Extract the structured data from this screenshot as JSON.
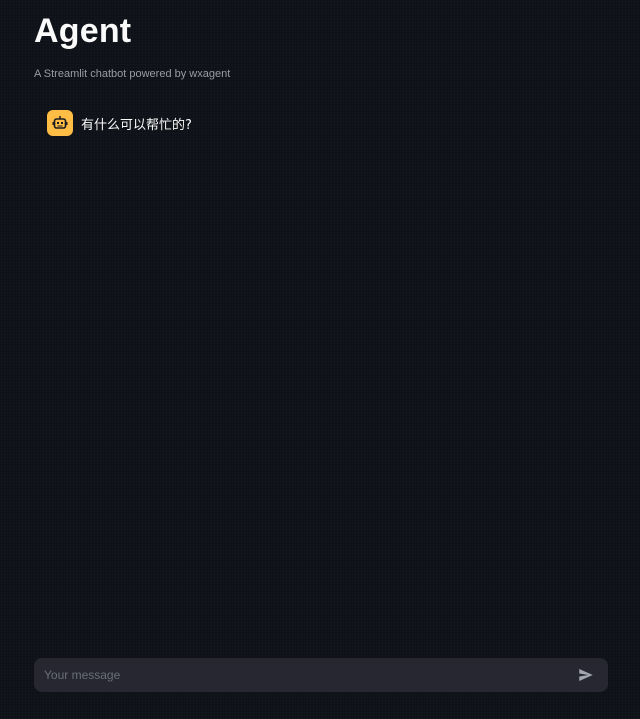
{
  "header": {
    "title": "Agent",
    "caption": "A Streamlit chatbot powered by wxagent"
  },
  "messages": [
    {
      "role": "assistant",
      "avatar_icon": "bot-icon",
      "text": "有什么可以帮忙的?"
    }
  ],
  "chat_input": {
    "placeholder": "Your message",
    "value": "",
    "send_icon": "send-icon"
  },
  "colors": {
    "background": "#0e1117",
    "avatar_bg": "#ffbd45",
    "input_bg": "#262730",
    "caption": "#9a9ca3"
  }
}
